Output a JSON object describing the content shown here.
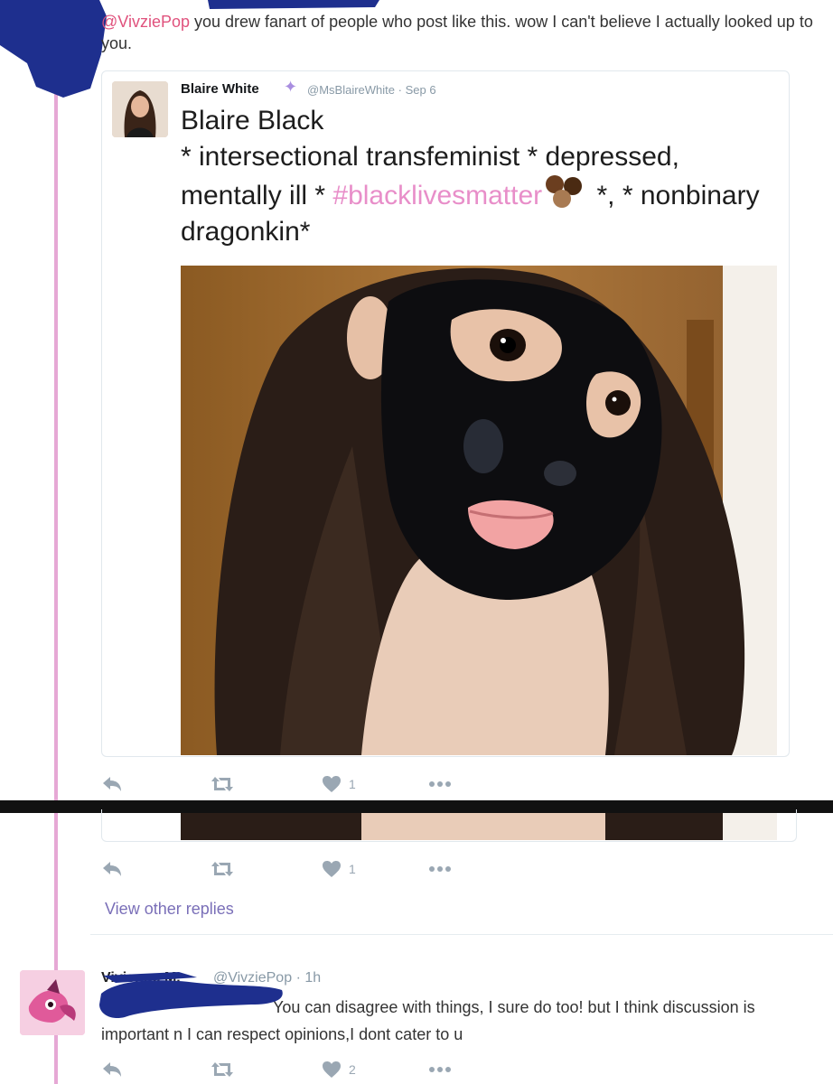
{
  "reply": {
    "mention": "@VivziePop",
    "text": " you drew fanart of people who post like this. wow I can't believe I actually looked up to you."
  },
  "quoted_tweet": {
    "author_name": "Blaire White",
    "handle": "@MsBlaireWhite",
    "separator": "·",
    "date": "Sep 6",
    "line1": "Blaire Black",
    "line2_pre": "* intersectional transfeminist * depressed, mentally ill * ",
    "hashtag": "#blacklivesmatter",
    "line2_post": " *, * nonbinary dragonkin*"
  },
  "actions_1": {
    "like_count": "1"
  },
  "actions_2": {
    "like_count": "1"
  },
  "view_other_replies": "View other replies",
  "bottom_reply": {
    "author_name": "Vivienne M.",
    "handle": "@VivziePop",
    "time": "1h",
    "text": "You can disagree with things, I sure do too! but I think discussion is important n I can respect opinions,I dont cater to u",
    "like_count": "2"
  },
  "colors": {
    "thread_line": "#e6a8d5",
    "mention": "#e0527d",
    "hashtag": "#e88ec9",
    "redaction": "#1e2f8e",
    "action_icons": "#9aa7b3"
  },
  "icons": {
    "reply": "reply-arrow-icon",
    "retweet": "retweet-icon",
    "like": "heart-icon",
    "more": "more-dots-icon",
    "verified": "sparkle-icon"
  }
}
